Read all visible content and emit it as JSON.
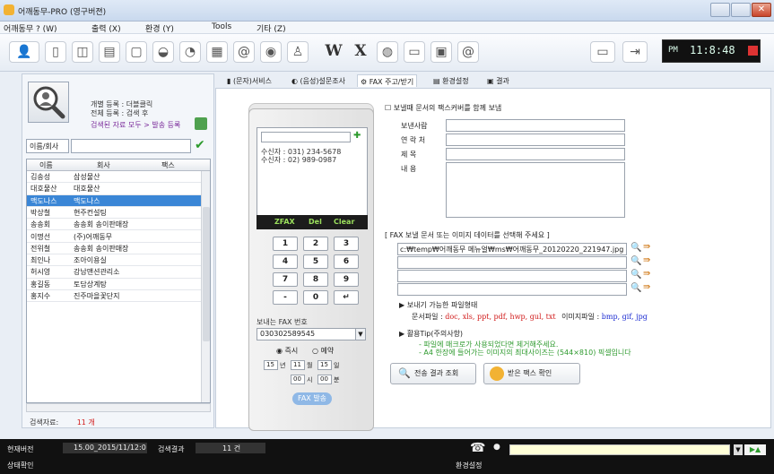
{
  "window": {
    "title": "어깨동무-PRO (영구버젼)"
  },
  "menu": [
    "어깨동무 ? (W)",
    "출력 (X)",
    "환경 (Y)",
    "Tools",
    "기타 (Z)"
  ],
  "clock": {
    "ampm": "PM",
    "time": "11:8:48"
  },
  "left": {
    "reg_individual": "개별 등록 : 더블클릭",
    "reg_all": "전체 등록 : 검색 후",
    "register_all_link": "검색된 자료 모두 > 발송 등록",
    "search_field": "이름/회사",
    "columns": [
      "이름",
      "회사",
      "팩스"
    ],
    "rows": [
      {
        "name": "김송성",
        "company": "삼성물산",
        "fax": ""
      },
      {
        "name": "대호물산",
        "company": "대호물산",
        "fax": ""
      },
      {
        "name": "맥도나스",
        "company": "맥도나스",
        "fax": ""
      },
      {
        "name": "박상철",
        "company": "현주컨설팅",
        "fax": ""
      },
      {
        "name": "송송회",
        "company": "송송회 송이판매장",
        "fax": ""
      },
      {
        "name": "이명선",
        "company": "(주)어깨동무",
        "fax": ""
      },
      {
        "name": "전위철",
        "company": "송송회 송이판매장",
        "fax": ""
      },
      {
        "name": "최인나",
        "company": "조아이용실",
        "fax": ""
      },
      {
        "name": "허시영",
        "company": "강남맨션관리소",
        "fax": ""
      },
      {
        "name": "홍길동",
        "company": "토담상계탕",
        "fax": ""
      },
      {
        "name": "홍지수",
        "company": "진주마을꽃단지",
        "fax": ""
      }
    ],
    "selected_index": 2,
    "total_label": "검색자료:",
    "total_count": "11 개"
  },
  "tabs": [
    "(문자)서비스",
    "(음성)설문조사",
    "FAX 주고/받기",
    "환경설정",
    "결과"
  ],
  "active_tab": 2,
  "phone": {
    "recipients": "수신자 : 031) 234-5678\n수신자 : 02) 989-0987",
    "keys_fx": [
      "ZFAX",
      "Del",
      "Clear"
    ],
    "keypad": [
      "1",
      "2",
      "3",
      "4",
      "5",
      "6",
      "7",
      "8",
      "9",
      "-",
      "0",
      "↵"
    ],
    "fax_label": "보내는 FAX 번호",
    "fax_number": "030302589545",
    "radio_now": "즉시",
    "radio_reserve": "예약",
    "date": {
      "year": "15",
      "year_u": "년",
      "month": "11",
      "month_u": "월",
      "day": "15",
      "day_u": "일",
      "hour": "00",
      "hour_u": "시",
      "minute": "00",
      "minute_u": "분"
    },
    "send_button": "FAX 발송"
  },
  "form": {
    "cover_check": "보낼때 문서의 팩스커버를 함께 보냄",
    "sender": "보낸사람",
    "contact": "연 락 처",
    "subject": "제 목",
    "content": "내 용",
    "files_title": "[ FAX 보낼 문서 또는 이미지 데이터를 선택해 주세요 ]",
    "files": [
      "c:₩temp₩어깨동무 메뉴얼₩ms₩어깨동무_20120220_221947.jpg",
      "",
      "",
      ""
    ],
    "types_title": "보내기 가능한 파일형태",
    "doc_label": "문서파일 :",
    "doc_types": "doc, xls, ppt, pdf, hwp, gul, txt",
    "img_label": "이미지파일 :",
    "img_types": "bmp, gif, jpg",
    "tip_title": "활용Tip(주의사항)",
    "tip1": "- 파일에 매크로가 사용되었다면 제거해주세요.",
    "tip2": "- A4 한장에 들어가는 이미지의 최대사이즈는 (544×810) 픽셀입니다",
    "btn_result": "전송 결과 조회",
    "btn_received": "받은 팩스 확인"
  },
  "status": {
    "version_label": "현재버전",
    "version": "15.00_2015/11/12:0",
    "search_label": "검색결과",
    "search_count": "11 건",
    "state_label": "상태확인",
    "settings": "환경설정"
  },
  "colors": {
    "accent": "#3a86d6",
    "doc_types": "#d11b1b",
    "img_types": "#1b2bd1",
    "tips": "#2e9a2e"
  }
}
